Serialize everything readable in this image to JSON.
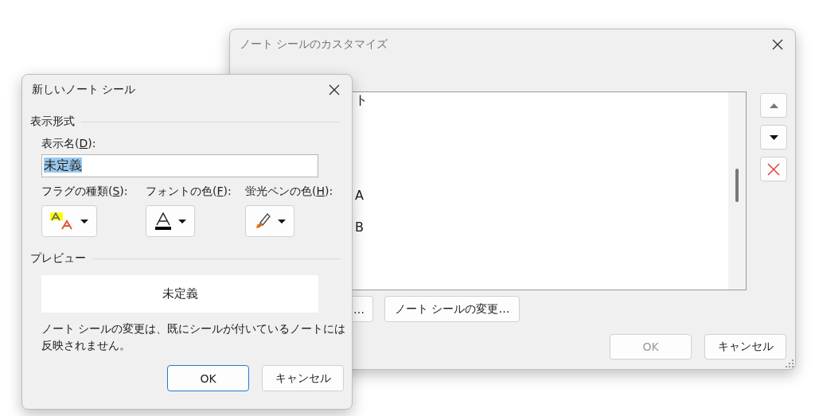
{
  "customize_dialog": {
    "title": "ノート シールのカスタマイズ",
    "active": false,
    "list_items": [
      {
        "text": "ト"
      },
      {
        "text": "A"
      },
      {
        "text": "B"
      }
    ],
    "side_buttons": [
      {
        "kind": "up"
      },
      {
        "kind": "down"
      },
      {
        "kind": "delete"
      }
    ],
    "buttons": [
      {
        "label": "…"
      },
      {
        "label": "ノート シールの変更…"
      }
    ],
    "footer_buttons": [
      {
        "label": "OK",
        "disabled": true
      },
      {
        "label": "キャンセル",
        "disabled": false
      }
    ]
  },
  "new_tag_dialog": {
    "title": "新しいノート シール",
    "active": true,
    "format_group": "表示形式",
    "display_name": {
      "label": {
        "before": "表示名(",
        "key": "D",
        "after": "):"
      },
      "value": "未定義",
      "value_selected": true
    },
    "dropdowns": [
      {
        "kind": "flag",
        "label": {
          "before": "フラグの種類(",
          "key": "S",
          "after": "):"
        }
      },
      {
        "kind": "font_color",
        "label": {
          "before": "フォントの色(",
          "key": "F",
          "after": "):"
        }
      },
      {
        "kind": "highlighter",
        "label": {
          "before": "蛍光ペンの色(",
          "key": "H",
          "after": "):"
        }
      }
    ],
    "preview_group": "プレビュー",
    "preview_text": "未定義",
    "note": "ノート シールの変更は、既にシールが付いているノートには反映されません。",
    "buttons": [
      {
        "label": "OK",
        "default": true
      },
      {
        "label": "キャンセル",
        "default": false
      }
    ]
  }
}
